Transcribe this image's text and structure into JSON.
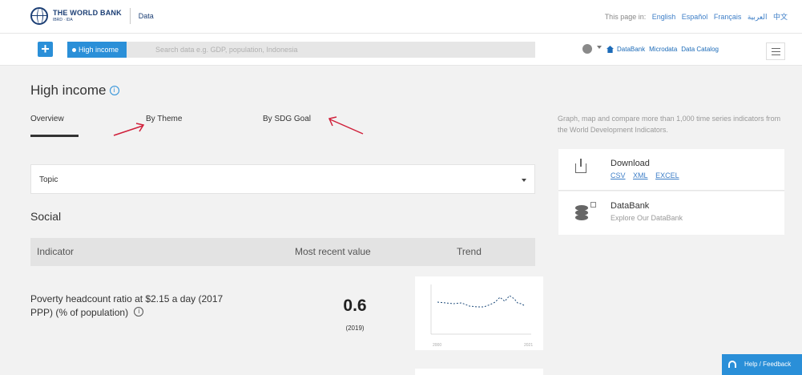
{
  "header": {
    "logo_name": "THE WORLD BANK",
    "logo_sub": "IBRD · IDA",
    "section_link": "Data",
    "lang_prefix": "This page in:",
    "languages": [
      "English",
      "Español",
      "Français",
      "العربية",
      "中文"
    ]
  },
  "search": {
    "chip_label": "High income",
    "placeholder": "Search data e.g. GDP, population, Indonesia",
    "links": [
      "DataBank",
      "Microdata",
      "Data Catalog"
    ]
  },
  "page": {
    "title": "High income",
    "tabs": [
      "Overview",
      "By Theme",
      "By SDG Goal"
    ],
    "topic_label": "Topic",
    "section_title": "Social",
    "columns": [
      "Indicator",
      "Most recent value",
      "Trend"
    ]
  },
  "indicator_row": {
    "name": "Poverty headcount ratio at $2.15 a day (2017 PPP) (% of population)",
    "value": "0.6",
    "year": "(2019)",
    "trend_start": "2000",
    "trend_end": "2021"
  },
  "sidebar": {
    "description": "Graph, map and compare more than 1,000 time series indicators from the World Development Indicators.",
    "download_title": "Download",
    "formats": [
      "CSV",
      "XML",
      "EXCEL"
    ],
    "databank_title": "DataBank",
    "databank_sub": "Explore Our DataBank"
  },
  "feedback": {
    "label": "Help / Feedback"
  },
  "colors": {
    "accent": "#2a8fd8",
    "brand": "#1c3f75",
    "annotation": "#d0203a"
  }
}
